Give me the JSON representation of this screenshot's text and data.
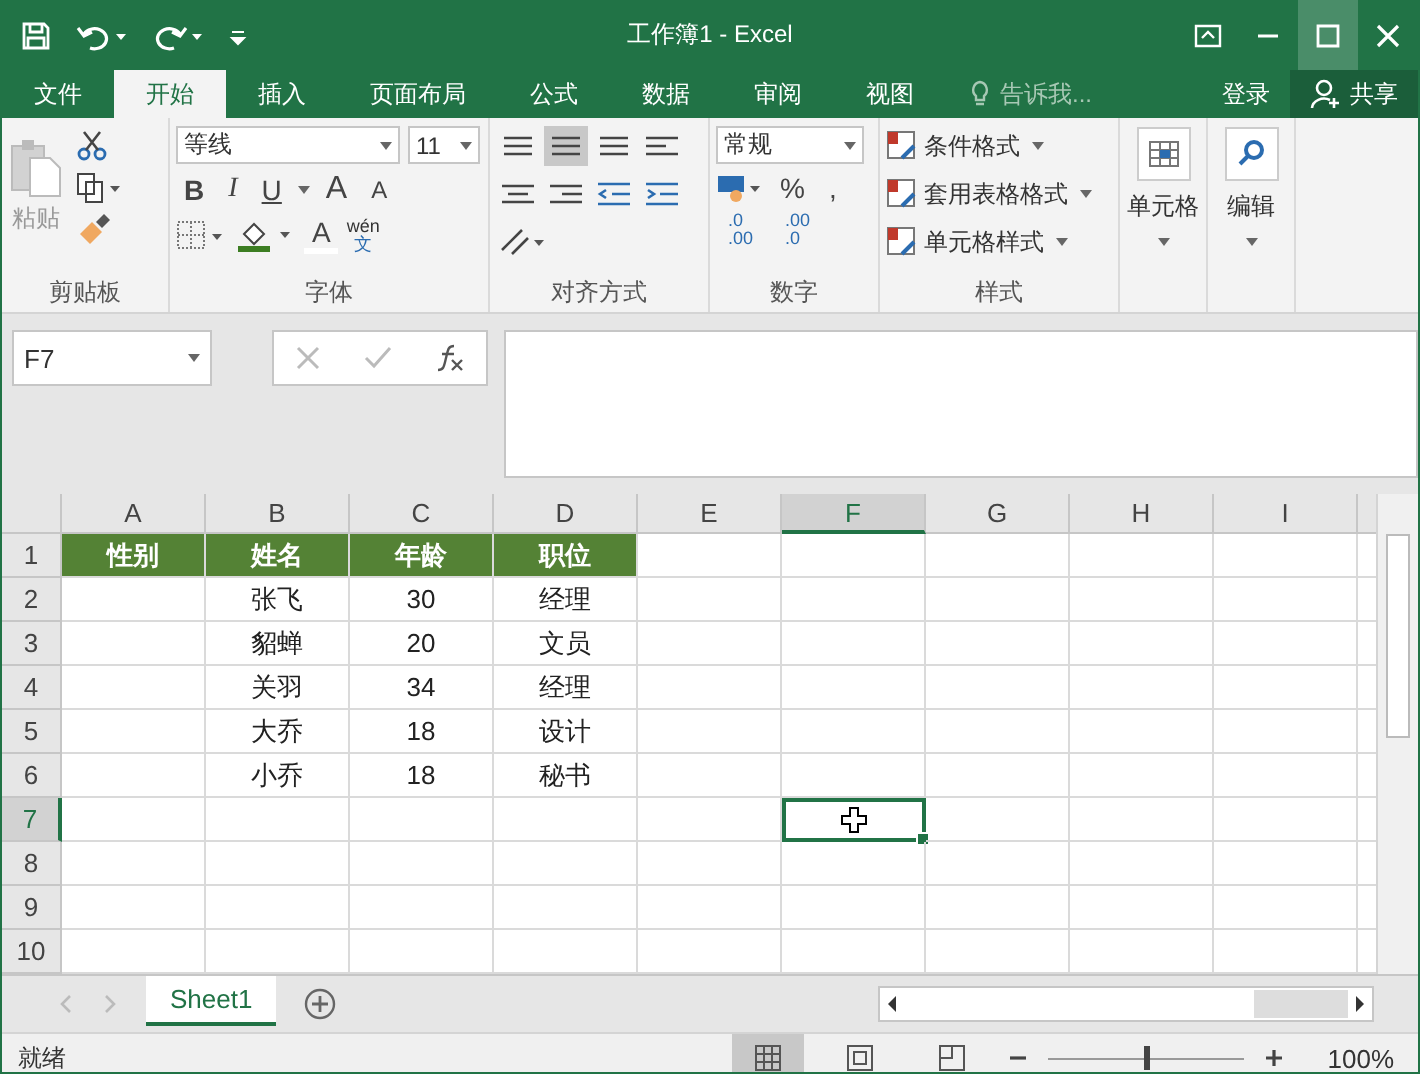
{
  "window": {
    "title": "工作簿1 - Excel"
  },
  "tabs": [
    {
      "label": "文件",
      "selected": false
    },
    {
      "label": "开始",
      "selected": true
    },
    {
      "label": "插入",
      "selected": false
    },
    {
      "label": "页面布局",
      "selected": false
    },
    {
      "label": "公式",
      "selected": false
    },
    {
      "label": "数据",
      "selected": false
    },
    {
      "label": "审阅",
      "selected": false
    },
    {
      "label": "视图",
      "selected": false
    }
  ],
  "tell_me": {
    "placeholder": "告诉我..."
  },
  "sign_in": "登录",
  "share": "共享",
  "ribbon": {
    "clipboard": {
      "label": "剪贴板",
      "paste": "粘贴"
    },
    "font": {
      "label": "字体",
      "font_name": "等线",
      "font_size": "11",
      "bold": "B",
      "italic": "I",
      "underline": "U",
      "grow": "A",
      "shrink": "A",
      "font_color": "A",
      "phonetic": "wén",
      "phonetic_char": "文"
    },
    "alignment": {
      "label": "对齐方式"
    },
    "number": {
      "label": "数字",
      "format": "常规",
      "percent": "%",
      "comma": ",",
      "inc_decimal": ".0\n.00",
      "dec_decimal": ".00\n.0"
    },
    "styles": {
      "label": "样式",
      "items": [
        "条件格式",
        "套用表格格式",
        "单元格样式"
      ]
    },
    "cells": {
      "label": "单元格"
    },
    "editing": {
      "label": "编辑"
    }
  },
  "name_box": "F7",
  "columns": [
    {
      "label": "A",
      "selected": false
    },
    {
      "label": "B",
      "selected": false
    },
    {
      "label": "C",
      "selected": false
    },
    {
      "label": "D",
      "selected": false
    },
    {
      "label": "E",
      "selected": false
    },
    {
      "label": "F",
      "selected": true
    },
    {
      "label": "G",
      "selected": false
    },
    {
      "label": "H",
      "selected": false
    },
    {
      "label": "I",
      "selected": false
    }
  ],
  "rows": [
    {
      "number": "1",
      "selected": false,
      "kind": "header",
      "cells": [
        "性别",
        "姓名",
        "年龄",
        "职位"
      ]
    },
    {
      "number": "2",
      "selected": false,
      "kind": "data",
      "cells": [
        null,
        "张飞",
        "30",
        "经理"
      ]
    },
    {
      "number": "3",
      "selected": false,
      "kind": "data",
      "cells": [
        null,
        "貂蝉",
        "20",
        "文员"
      ]
    },
    {
      "number": "4",
      "selected": false,
      "kind": "data",
      "cells": [
        null,
        "关羽",
        "34",
        "经理"
      ]
    },
    {
      "number": "5",
      "selected": false,
      "kind": "data",
      "cells": [
        null,
        "大乔",
        "18",
        "设计"
      ]
    },
    {
      "number": "6",
      "selected": false,
      "kind": "data",
      "cells": [
        null,
        "小乔",
        "18",
        "秘书"
      ]
    },
    {
      "number": "7",
      "selected": true,
      "kind": "data"
    },
    {
      "number": "8",
      "selected": false,
      "kind": "data"
    },
    {
      "number": "9",
      "selected": false,
      "kind": "data"
    },
    {
      "number": "10",
      "selected": false,
      "kind": "data"
    }
  ],
  "sheets": [
    {
      "label": "Sheet1",
      "selected": true
    }
  ],
  "status": {
    "text": "就绪",
    "views": [
      {
        "kind": "normal",
        "selected": true
      },
      {
        "kind": "page_layout",
        "selected": false
      },
      {
        "kind": "page_break",
        "selected": false
      }
    ],
    "zoom": {
      "level": 0.5,
      "reading": "100%"
    }
  }
}
